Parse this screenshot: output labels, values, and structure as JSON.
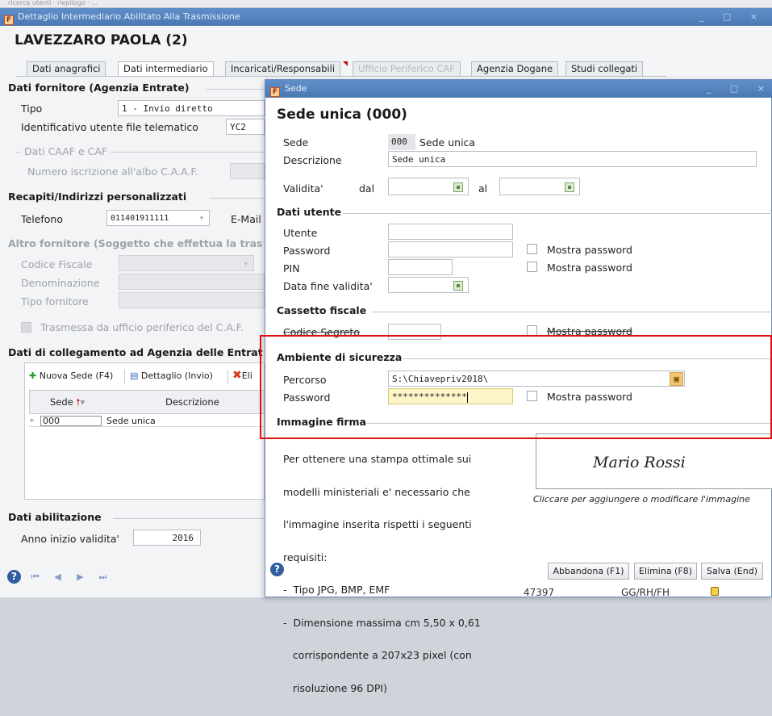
{
  "top_strip": "ricerca utenti  ·  riepilogo  ·  ...",
  "window": {
    "icon": "F",
    "title": "Dettaglio Intermediario Abilitato Alla Trasmissione",
    "controls": "_ □ ×",
    "heading": "LAVEZZARO PAOLA (2)"
  },
  "tabs": [
    {
      "label": "Dati anagrafici"
    },
    {
      "label": "Dati intermediario"
    },
    {
      "label": "Incaricati/Responsabili"
    },
    {
      "label": "Ufficio Periferico CAF"
    },
    {
      "label": "Agenzia Dogane"
    },
    {
      "label": "Studi collegati"
    }
  ],
  "fornitore": {
    "section": "Dati fornitore (Agenzia Entrate)",
    "tipo_label": "Tipo",
    "tipo_value": "1 - Invio diretto",
    "id_label": "Identificativo utente file telematico",
    "id_value": "YC2",
    "caaf_group": "Dati CAAF e CAF",
    "caaf_label": "Numero iscrizione all'albo C.A.A.F."
  },
  "recapiti": {
    "section": "Recapiti/Indirizzi personalizzati",
    "tel_label": "Telefono",
    "tel_value": "011401911111",
    "email_label": "E-Mail"
  },
  "altro": {
    "section": "Altro fornitore (Soggetto che effettua la tras",
    "cf_label": "Codice Fiscale",
    "den_label": "Denominazione",
    "tipo_label": "Tipo fornitore",
    "trasmessa": "Trasmessa da ufficio periferico del C.A.F."
  },
  "collegamento": {
    "section": "Dati di collegamento ad Agenzia delle Entrat",
    "btn_new": "Nuova Sede (F4)",
    "btn_detail": "Dettaglio (Invio)",
    "btn_del": "Eli",
    "col_sede": "Sede",
    "col_desc": "Descrizione",
    "rows": [
      {
        "sede": "000",
        "desc": "Sede unica"
      }
    ]
  },
  "abilitazione": {
    "section": "Dati abilitazione",
    "anno_label": "Anno inizio validita'",
    "anno_value": "2016"
  },
  "dialog": {
    "icon": "F",
    "title": "Sede",
    "controls": "_ □ ×",
    "heading": "Sede unica (000)",
    "sede_label": "Sede",
    "sede_code": "000",
    "sede_name": "Sede unica",
    "desc_label": "Descrizione",
    "desc_value": "Sede unica",
    "validita_label": "Validita'",
    "dal_label": "dal",
    "al_label": "al",
    "utente_section": "Dati utente",
    "utente_label": "Utente",
    "password_label": "Password",
    "pin_label": "PIN",
    "fine_label": "Data fine validita'",
    "mostra": "Mostra password",
    "cassetto_section": "Cassetto fiscale",
    "codice_label": "Codice Segreto",
    "sicurezza_section": "Ambiente di sicurezza",
    "percorso_label": "Percorso",
    "percorso_value": "S:\\Chiavepriv2018\\",
    "sic_password_label": "Password",
    "sic_password_value": "**************",
    "firma_section": "Immagine firma",
    "firma_text": [
      "Per ottenere una stampa ottimale sui",
      "modelli ministeriali e' necessario che",
      "l'immagine inserita rispetti i seguenti",
      "requisiti:",
      "-  Tipo JPG, BMP, EMF",
      "-  Dimensione massima cm 5,50 x 0,61",
      "   corrispondente a 207x23 pixel (con",
      "   risoluzione 96 DPI)"
    ],
    "firma_signature": "Mario Rossi",
    "firma_hint": "Cliccare per aggiungere o modificare l'immagine",
    "btn_abbandona": "Abbandona (F1)",
    "btn_elimina": "Elimina (F8)",
    "btn_salva": "Salva (End)",
    "status_a": "47397",
    "status_b": "GG/RH/FH"
  }
}
